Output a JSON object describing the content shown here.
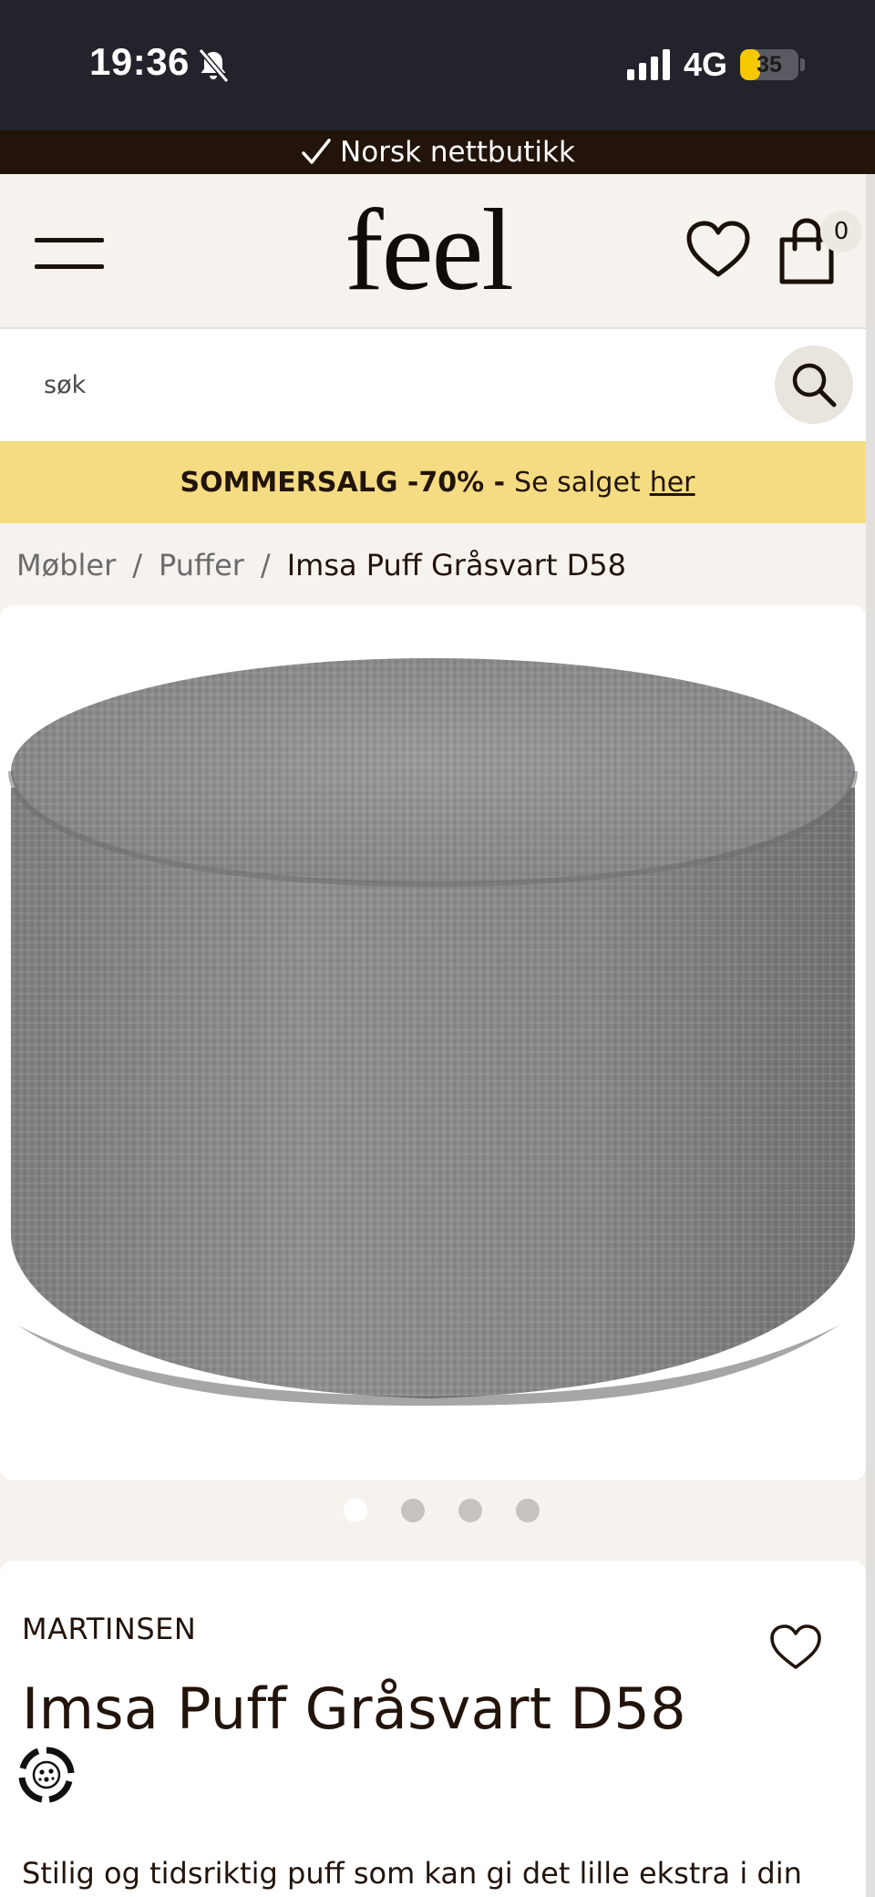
{
  "status_bar": {
    "time": "19:36",
    "network": "4G",
    "battery_level": "35",
    "battery_fraction": 0.35,
    "icons": [
      "bell-off-icon",
      "signal-icon",
      "battery-icon"
    ]
  },
  "trust_banner": {
    "text": "Norsk nettbutikk",
    "icon": "checkmark-icon"
  },
  "header": {
    "logo": "feel",
    "cart_count": "0",
    "icons": [
      "menu-icon",
      "heart-icon",
      "shopping-bag-icon"
    ]
  },
  "search": {
    "placeholder": "søk",
    "icon": "search-icon"
  },
  "promo": {
    "bold_text": "SOMMERSALG -70% -",
    "text": "Se salget",
    "link_text": "her"
  },
  "breadcrumb": {
    "items": [
      "Møbler",
      "Puffer",
      "Imsa Puff Gråsvart D58"
    ],
    "separator": "/"
  },
  "gallery": {
    "image_subject": "grey round fabric pouf",
    "total_images": 4,
    "active_index": 0
  },
  "product": {
    "brand": "MARTINSEN",
    "title": "Imsa Puff Gråsvart D58",
    "description": "Stilig og tidsriktig puff som kan gi det lille ekstra i din"
  },
  "colors": {
    "status_bar_bg": "#22232b",
    "trust_banner_bg": "#22140b",
    "promo_bg": "#f5dc82",
    "page_bg": "#f6f3ee",
    "text": "#22140b",
    "battery_yellow": "#f5c800"
  }
}
